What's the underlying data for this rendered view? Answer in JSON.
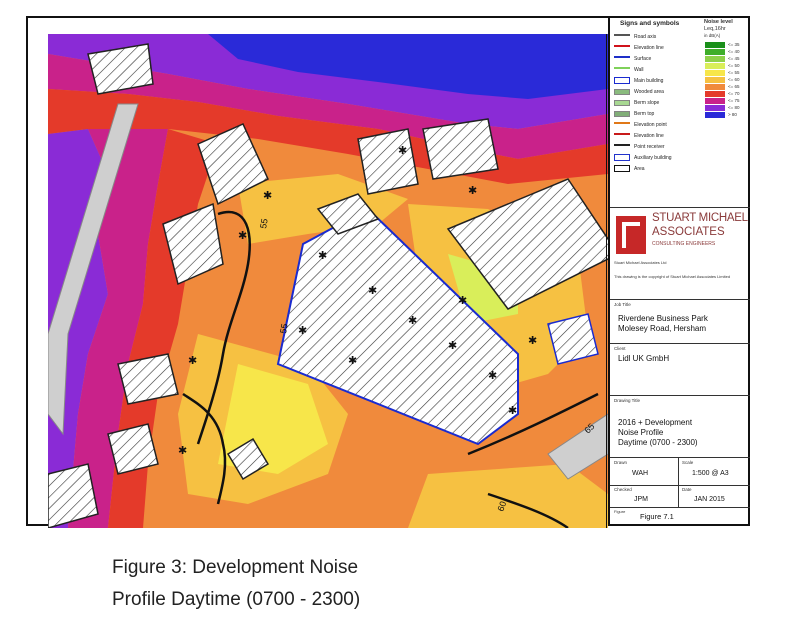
{
  "legend": {
    "title": "Signs and symbols",
    "items": [
      {
        "label": "Road axis",
        "color": "#555555"
      },
      {
        "label": "Elevation line",
        "color": "#d0121b"
      },
      {
        "label": "Surface",
        "color": "#1e2fc8"
      },
      {
        "label": "Wall",
        "color": "#7fd15a"
      },
      {
        "label": "Main building",
        "color": "#1a2bd0"
      },
      {
        "label": "Wooded area",
        "color": "#3e8e2a"
      },
      {
        "label": "Berm slope",
        "color": "#6fbf4a"
      },
      {
        "label": "Berm top",
        "color": "#2f7a20"
      },
      {
        "label": "Elevation point",
        "color": "#e07818"
      },
      {
        "label": "Elevation line",
        "color": "#c81a1a"
      },
      {
        "label": "Point receiver",
        "color": "#222222"
      },
      {
        "label": "Auxiliary building",
        "color": "#2233cc"
      },
      {
        "label": "Area",
        "color": "#111111"
      }
    ]
  },
  "noise_level": {
    "title": "Noise level",
    "subtitle": "Leq,16hr",
    "unit": "in dB(A)",
    "bands": [
      {
        "label": "<= 35",
        "color": "#1a8f1a"
      },
      {
        "label": "<= 40",
        "color": "#3fae2a"
      },
      {
        "label": "<= 45",
        "color": "#8fd14a"
      },
      {
        "label": "<= 50",
        "color": "#d9ee5a"
      },
      {
        "label": "<= 55",
        "color": "#f7e64a"
      },
      {
        "label": "<= 60",
        "color": "#f6c142"
      },
      {
        "label": "<= 65",
        "color": "#f08a3c"
      },
      {
        "label": "<= 70",
        "color": "#e43a2a"
      },
      {
        "label": "<= 75",
        "color": "#c9228a"
      },
      {
        "label": "<= 80",
        "color": "#8a2bd6"
      },
      {
        "label": "> 80",
        "color": "#2a2ad8"
      }
    ]
  },
  "company": {
    "name_line1": "STUART MICHAEL",
    "name_line2": "ASSOCIATES",
    "tagline": "CONSULTING ENGINEERS",
    "address": "Stuart Michael Associates Ltd",
    "copyright": "This drawing is the copyright of Stuart Michael Associates Limited"
  },
  "title_block": {
    "job_title_label": "Job Title",
    "job_title_line1": "Riverdene Business Park",
    "job_title_line2": "Molesey Road, Hersham",
    "client_label": "Client",
    "client": "Lidl UK GmbH",
    "drawing_title_label": "Drawing Title",
    "drawing_title_line1": "2016 + Development",
    "drawing_title_line2": "Noise Profile",
    "drawing_title_line3": "Daytime (0700 - 2300)",
    "drawn_label": "Drawn",
    "drawn": "WAH",
    "scale_label": "Scale",
    "scale": "1:500 @ A3",
    "checked_label": "Checked",
    "checked": "JPM",
    "date_label": "Date",
    "date": "JAN 2015",
    "figure_label": "Figure",
    "figure": "Figure 7.1"
  },
  "map_labels": {
    "contour_55": "55",
    "contour_60": "60",
    "contour_65": "65"
  },
  "caption": {
    "line1": "Figure 3: Development Noise",
    "line2": "Profile Daytime (0700 - 2300)"
  }
}
